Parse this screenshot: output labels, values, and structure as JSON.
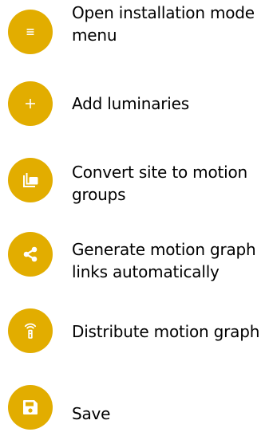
{
  "accent_color": "#e2ad00",
  "items": [
    {
      "icon": "menu-icon",
      "label": "Open installation mode menu"
    },
    {
      "icon": "plus-icon",
      "label": "Add luminaries"
    },
    {
      "icon": "layers-icon",
      "label": "Convert site to motion groups"
    },
    {
      "icon": "share-icon",
      "label": "Generate motion graph links automatically"
    },
    {
      "icon": "remote-icon",
      "label": "Distribute motion graph"
    },
    {
      "icon": "save-icon",
      "label": "Save"
    }
  ]
}
